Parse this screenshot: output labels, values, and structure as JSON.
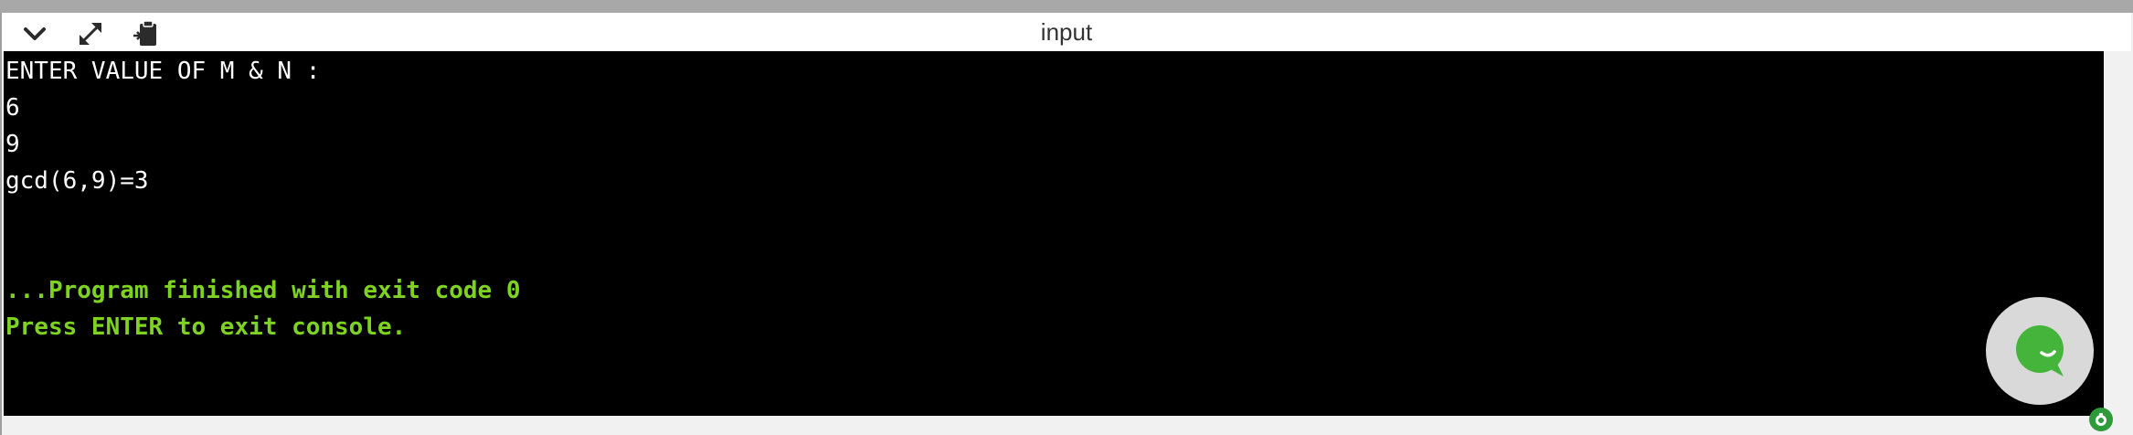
{
  "window": {
    "title": "input"
  },
  "toolbar": {
    "buttons": [
      {
        "icon": "chevron-down-icon"
      },
      {
        "icon": "expand-icon"
      },
      {
        "icon": "clipboard-paste-icon"
      }
    ]
  },
  "console": {
    "lines": [
      {
        "text": "ENTER VALUE OF M & N :",
        "style": "normal"
      },
      {
        "text": "6",
        "style": "normal"
      },
      {
        "text": "9",
        "style": "normal"
      },
      {
        "text": "gcd(6,9)=3",
        "style": "normal"
      },
      {
        "text": "",
        "style": "normal"
      },
      {
        "text": "",
        "style": "normal"
      },
      {
        "text": "...Program finished with exit code 0",
        "style": "status"
      },
      {
        "text": "Press ENTER to exit console.",
        "style": "status"
      }
    ]
  },
  "widgets": {
    "chat_icon": "chat-icon",
    "badge_icon": "support-badge-icon"
  },
  "colors": {
    "console_bg": "#000000",
    "console_text": "#ffffff",
    "status_text": "#7ed321",
    "chat_green": "#45b43a"
  }
}
